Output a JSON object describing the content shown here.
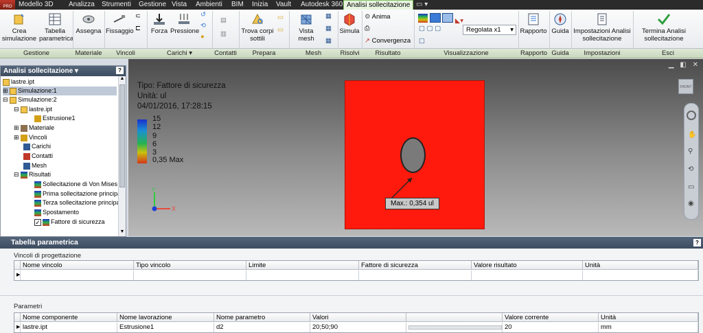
{
  "menubar": {
    "logo": "PRO",
    "tabs": [
      "Modello 3D",
      "Analizza",
      "Strumenti",
      "Gestione",
      "Vista",
      "Ambienti",
      "BIM",
      "Inizia",
      "Vault",
      "Autodesk 360",
      "Analisi sollecitazione"
    ],
    "active_tab": "Analisi sollecitazione"
  },
  "ribbon": {
    "crea": "Crea simulazione",
    "tabella": "Tabella parametrica",
    "assegna": "Assegna",
    "fissaggio": "Fissaggio",
    "forza": "Forza",
    "pressione": "Pressione",
    "trova": "Trova corpi sottili",
    "vista_mesh": "Vista mesh",
    "simula": "Simula",
    "anima": "Anima",
    "convergenza": "Convergenza",
    "regolata": "Regolata x1",
    "rapporto": "Rapporto",
    "guida": "Guida",
    "impostazioni": "Impostazioni Analisi sollecitazione",
    "termina": "Termina Analisi sollecitazione"
  },
  "groups": [
    "Gestione",
    "Materiale",
    "Vincoli",
    "Carichi",
    "Contatti",
    "Prepara",
    "Mesh",
    "Risolvi",
    "Risultato",
    "Visualizzazione",
    "Rapporto",
    "Guida",
    "Impostazioni",
    "Esci"
  ],
  "browser": {
    "title": "Analisi sollecitazione",
    "nodes": [
      "lastre.ipt",
      "Simulazione:1",
      "Simulazione:2",
      "lastre.ipt",
      "Estrusione1",
      "Materiale",
      "Vincoli",
      "Carichi",
      "Contatti",
      "Mesh",
      "Risultati",
      "Sollecitazione di Von Mises",
      "Prima sollecitazione principale",
      "Terza sollecitazione principale",
      "Spostamento",
      "Fattore di sicurezza"
    ]
  },
  "viewport": {
    "type": "Tipo: Fattore di sicurezza",
    "unit": "Unità: ul",
    "date": "04/01/2016, 17:28:15",
    "legend": [
      "15",
      "12",
      "9",
      "6",
      "3",
      "0,35 Max"
    ],
    "max_label": "Max.: 0,354 ul",
    "axis_x": "X",
    "axis_y": "Y",
    "viewcube_label": "FRONT"
  },
  "panel": {
    "title": "Tabella parametrica",
    "constraints_title": "Vincoli di progettazione",
    "constraints_headers": [
      "Nome vincolo",
      "Tipo vincolo",
      "Limite",
      "Fattore di sicurezza",
      "Valore risultato",
      "Unità"
    ],
    "params_title": "Parametri",
    "params_headers": [
      "Nome componente",
      "Nome lavorazione",
      "Nome parametro",
      "Valori",
      "",
      "Valore corrente",
      "Unità"
    ],
    "params_row": [
      "lastre.ipt",
      "Estrusione1",
      "d2",
      "20;50;90",
      "",
      "20",
      "mm"
    ]
  },
  "colors": {
    "plate": "#ff1a0d",
    "hole": "#7a7a7a",
    "accent": "#7fbf5f"
  }
}
